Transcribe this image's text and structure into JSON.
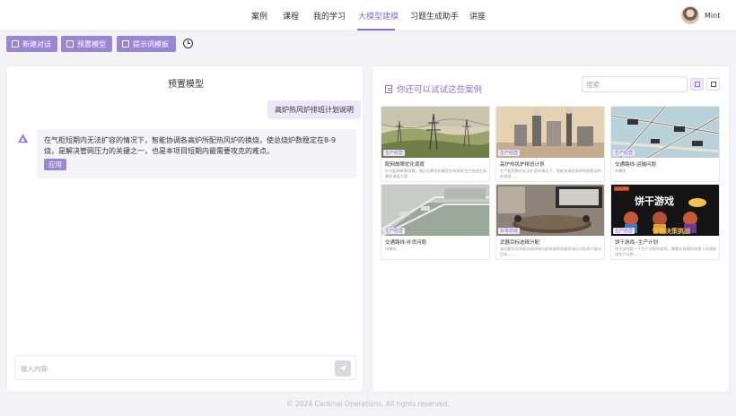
{
  "nav": {
    "items": [
      "案例",
      "课程",
      "我的学习",
      "大模型建模",
      "习题生成助手",
      "讲座"
    ],
    "active": "大模型建模"
  },
  "user": {
    "name": "Mint"
  },
  "toolbar": {
    "new_chat": "新建对话",
    "preset_model": "预置模型",
    "prompt_template": "提示词模板"
  },
  "chat": {
    "title": "预置模型",
    "user_message": "高炉热风炉排班计划说明",
    "bot_message": "在气柜短期内无法扩容的情况下，智能协调各高炉所配热风炉的换烧，使总烧炉数稳定在8-9烧，是解决管网压力的关键之一，也是本项目短期内最需要攻克的难点。",
    "apply_label": "应用",
    "input_placeholder": "输入内容"
  },
  "cases": {
    "title": "你还可以试试这些案例",
    "search_placeholder": "搜索",
    "cards": [
      {
        "title": "配网故障优化调度",
        "tag": "生产经营",
        "desc": "针对配网故障场景，通过运筹优化模型在故障发生后快速生成最优调度方案……"
      },
      {
        "title": "高炉热风炉排班计划",
        "tag": "生产经营",
        "desc": "在气柜短期内无法扩容的情况下，智能协调各高炉所配热风炉的换烧……"
      },
      {
        "title": "交通路线-运输问题",
        "tag": "生产经营",
        "desc": "待補充"
      },
      {
        "title": "交通路线-补货问题",
        "tag": "生产经营",
        "desc": "待補充"
      },
      {
        "title": "武器目标选择分配",
        "tag": "军事领域",
        "desc": "该问题涉及到如何选择和分配有限的武器资源以对抗多个敌方目标……"
      },
      {
        "title": "饼干游戏--生产计划",
        "tag": "生产经营",
        "desc": "饼干游戏是一个生产决策的游戏，需要在有限的资源下合理安排生产计划……"
      }
    ],
    "poster_brand": "SOCAM",
    "poster_title": "饼干游戏",
    "poster_subtitle": "智能决策挑战"
  },
  "footer": {
    "text": "© 2024 Cardinal Operations. All rights reserved."
  },
  "colors": {
    "accent": "#8a73d0",
    "button": "#9b86d4",
    "bubble": "#ece8f8"
  }
}
